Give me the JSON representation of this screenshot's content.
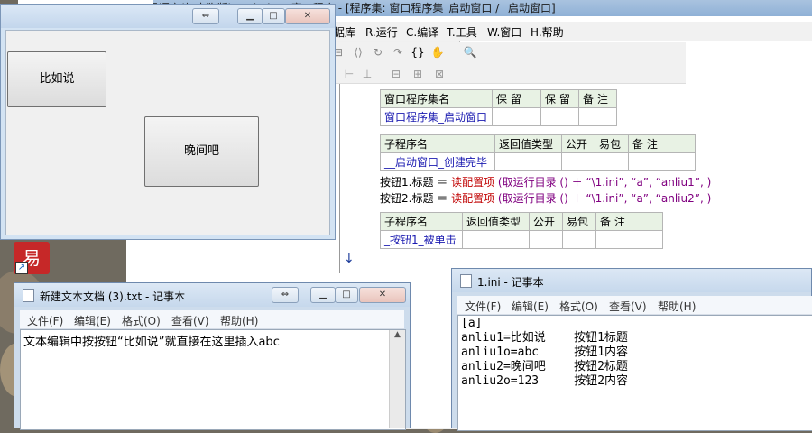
{
  "ide": {
    "title": "易语言(加密狗版) - Windows窗口程序 - [程序集: 窗口程序集_启动窗口 / _启动窗口]",
    "menus": [
      "据库",
      "R.运行",
      "C.编译",
      "T.工具",
      "W.窗口",
      "H.帮助"
    ],
    "toolbar_icons": [
      "view-icon",
      "view2-icon",
      "view3-icon",
      "run-icon",
      "stop-icon",
      "step-icon",
      "step-into-icon",
      "step-out-icon",
      "step-over-icon",
      "braces-icon",
      "hand-icon",
      "search-icon"
    ],
    "assembly_table": {
      "headers": [
        "窗口程序集名",
        "保 留",
        "保 留",
        "备 注"
      ],
      "row": [
        "窗口程序集_启动窗口",
        "",
        "",
        ""
      ]
    },
    "sub1_table": {
      "headers": [
        "子程序名",
        "返回值类型",
        "公开",
        "易包",
        "备 注"
      ],
      "row": [
        "__启动窗口_创建完毕",
        "",
        "",
        "",
        ""
      ]
    },
    "code_lines": [
      {
        "lhs": "按钮1.标题 ＝ ",
        "fn": "读配置项",
        "args": " (取运行目录 () ＋ “\\1.ini”, “a”, “anliu1”, )"
      },
      {
        "lhs": "按钮2.标题 ＝ ",
        "fn": "读配置项",
        "args": " (取运行目录 () ＋ “\\1.ini”, “a”, “anliu2”, )"
      }
    ],
    "sub2_table": {
      "headers": [
        "子程序名",
        "返回值类型",
        "公开",
        "易包",
        "备 注"
      ],
      "row": [
        "_按钮1_被单击",
        "",
        "",
        "",
        ""
      ]
    }
  },
  "form_window": {
    "buttons": [
      "比如说",
      "晚间吧"
    ]
  },
  "notepad1": {
    "title": "新建文本文档 (3).txt - 记事本",
    "menus": [
      "文件(F)",
      "编辑(E)",
      "格式(O)",
      "查看(V)",
      "帮助(H)"
    ],
    "content": "文本编辑中按按钮“比如说”就直接在这里插入abc"
  },
  "notepad2": {
    "title": "1.ini - 记事本",
    "menus": [
      "文件(F)",
      "编辑(E)",
      "格式(O)",
      "查看(V)",
      "帮助(H)"
    ],
    "lines": [
      "[a]",
      "anliu1=比如说    按钮1标题",
      "anliu1o=abc     按钮1内容",
      "anliu2=晚间吧    按钮2标题",
      "anliu2o=123     按钮2内容"
    ]
  },
  "caption_symbols": {
    "restore": "⇔",
    "minimize": "▁",
    "maximize": "□",
    "close": "✕"
  }
}
